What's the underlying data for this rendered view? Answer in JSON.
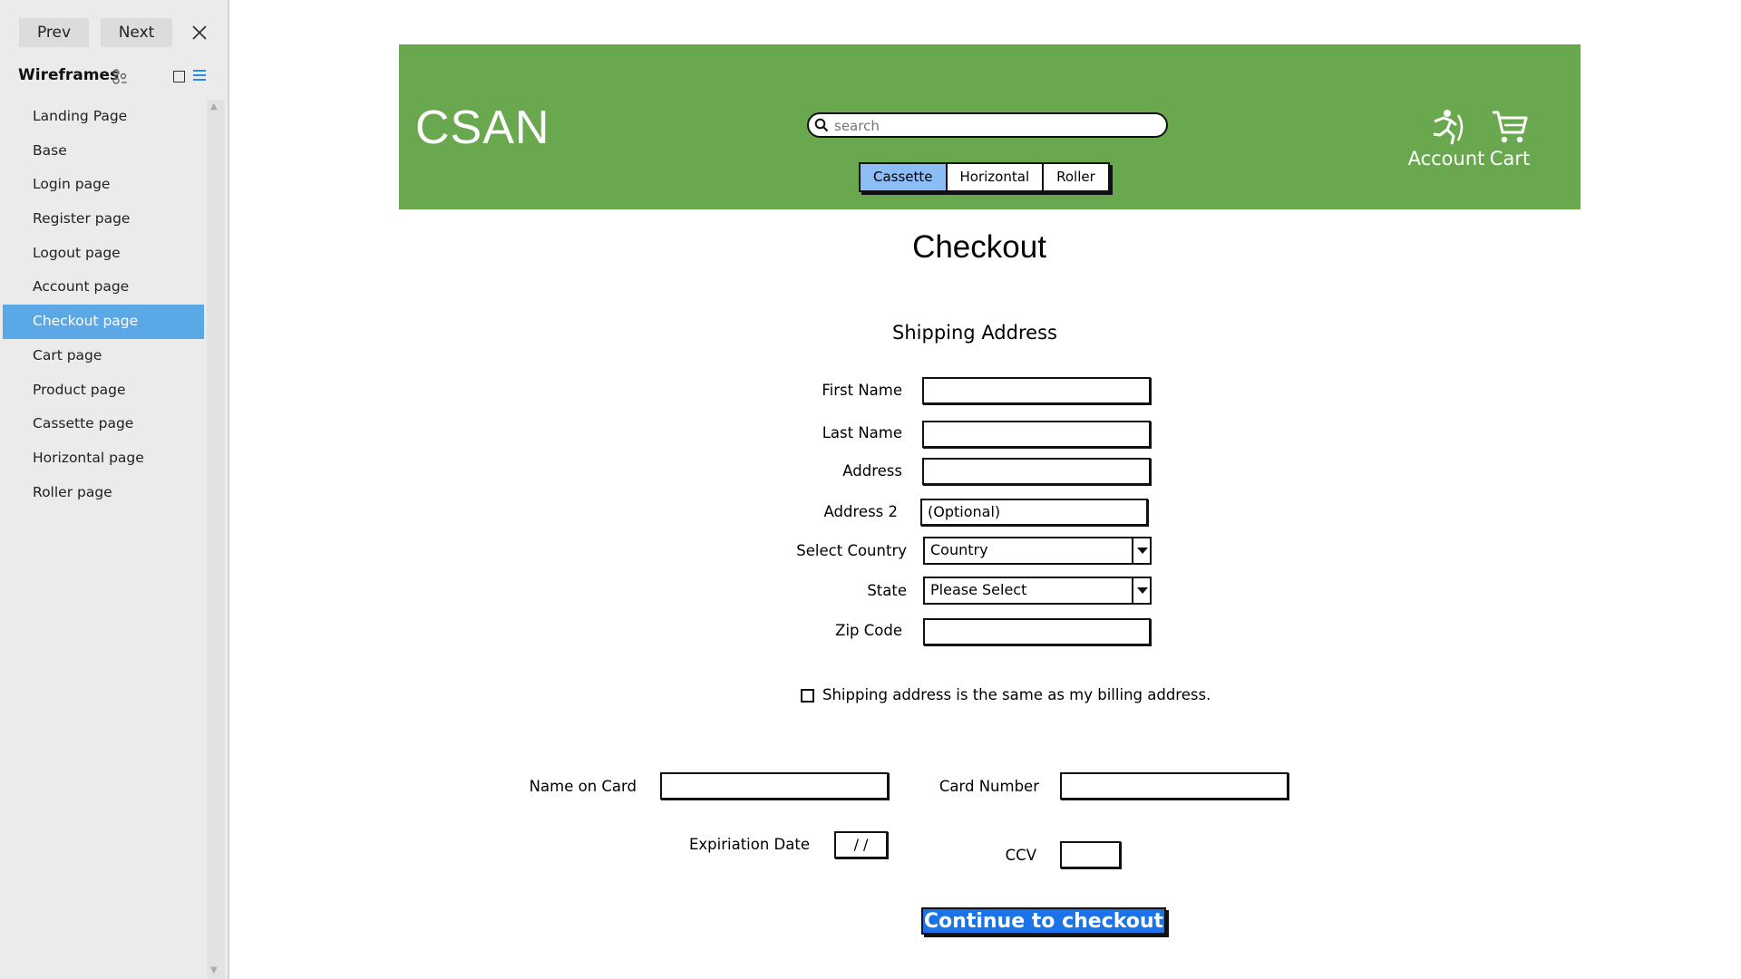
{
  "panel": {
    "prev_label": "Prev",
    "next_label": "Next",
    "title": "Wireframes",
    "pages": [
      {
        "label": "Landing Page",
        "active": false
      },
      {
        "label": "Base",
        "active": false
      },
      {
        "label": "Login page",
        "active": false
      },
      {
        "label": "Register page",
        "active": false
      },
      {
        "label": "Logout page",
        "active": false
      },
      {
        "label": "Account page",
        "active": false
      },
      {
        "label": "Checkout page",
        "active": true
      },
      {
        "label": "Cart page",
        "active": false
      },
      {
        "label": "Product page",
        "active": false
      },
      {
        "label": "Cassette page",
        "active": false
      },
      {
        "label": "Horizontal page",
        "active": false
      },
      {
        "label": "Roller page",
        "active": false
      }
    ]
  },
  "header": {
    "logo": "CSAN",
    "search_placeholder": "search",
    "tabs": [
      {
        "label": "Cassette",
        "selected": true
      },
      {
        "label": "Horizontal",
        "selected": false
      },
      {
        "label": "Roller",
        "selected": false
      }
    ],
    "account_label": "Account",
    "cart_label": "Cart"
  },
  "checkout": {
    "title": "Checkout",
    "shipping_title": "Shipping Address",
    "first_name_label": "First Name",
    "last_name_label": "Last Name",
    "address_label": "Address",
    "address2_label": "Address 2",
    "address2_value": "(Optional)",
    "country_label": "Select Country",
    "country_value": "Country",
    "state_label": "State",
    "state_value": "Please Select",
    "zip_label": "Zip Code",
    "same_address_label": "Shipping address is the same as my billing address.",
    "name_on_card_label": "Name on Card",
    "card_number_label": "Card Number",
    "expiration_label": "Expiriation Date",
    "expiration_value": "/ /",
    "ccv_label": "CCV",
    "submit_label": "Continue to checkout"
  },
  "colors": {
    "header_bg": "#6aa84f",
    "selected_page": "#5aa9e6",
    "selected_tab": "#8cbdf5",
    "submit_bg": "#1a73e8"
  }
}
